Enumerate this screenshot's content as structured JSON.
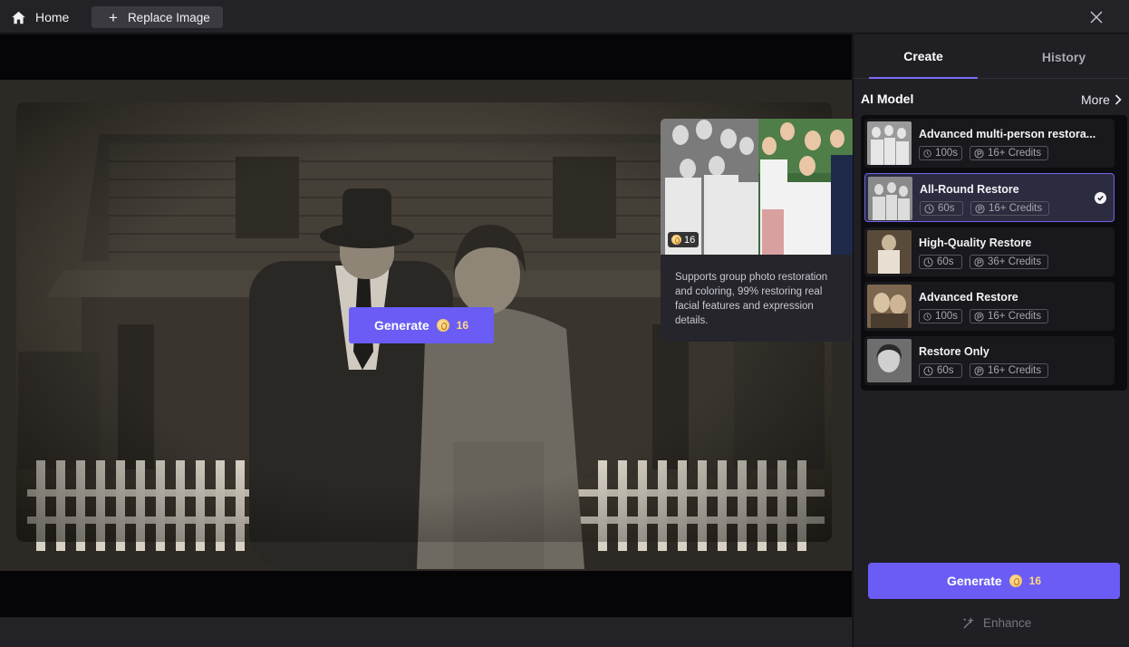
{
  "topbar": {
    "home_label": "Home",
    "replace_label": "Replace Image"
  },
  "canvas": {
    "generate_label": "Generate",
    "generate_credits": "16"
  },
  "tooltip": {
    "badge_credits": "16",
    "description": "Supports group photo restoration and coloring, 99% restoring real facial features and expression details."
  },
  "panel": {
    "tabs": [
      {
        "label": "Create"
      },
      {
        "label": "History"
      }
    ],
    "ai_model_title": "AI Model",
    "more_label": "More",
    "models": [
      {
        "name": "Advanced multi-person restora...",
        "time": "100s",
        "credits": "16+ Credits",
        "selected": false
      },
      {
        "name": "All-Round Restore",
        "time": "60s",
        "credits": "16+ Credits",
        "selected": true
      },
      {
        "name": "High-Quality Restore",
        "time": "60s",
        "credits": "36+ Credits",
        "selected": false
      },
      {
        "name": "Advanced Restore",
        "time": "100s",
        "credits": "16+ Credits",
        "selected": false
      },
      {
        "name": "Restore Only",
        "time": "60s",
        "credits": "16+ Credits",
        "selected": false
      }
    ],
    "generate_label": "Generate",
    "generate_credits": "16",
    "enhance_label": "Enhance"
  },
  "colors": {
    "accent": "#6a5cf5",
    "selected_border": "#6f64e9",
    "credit_gold": "#ffd984"
  },
  "icons": [
    "home-icon",
    "plus-icon",
    "close-icon",
    "chevron-right-icon",
    "clock-icon",
    "credit-icon",
    "check-icon",
    "coin-icon",
    "enhance-wand-icon"
  ]
}
